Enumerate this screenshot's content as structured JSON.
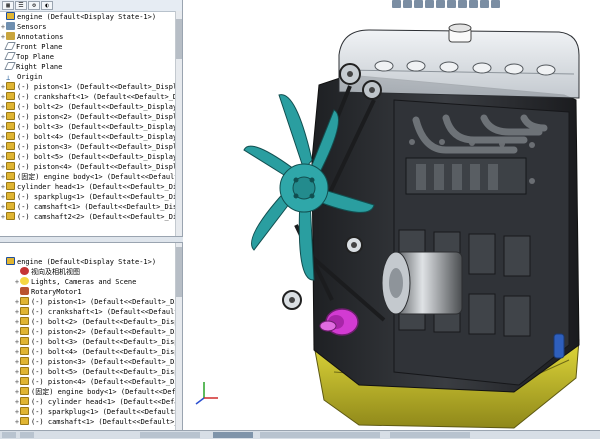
{
  "tree_top": {
    "root": "engine  (Default<Display State-1>)",
    "items": [
      {
        "label": "Sensors",
        "icon": "sensor-icon"
      },
      {
        "label": "Annotations",
        "icon": "annotation-icon"
      },
      {
        "label": "Front Plane",
        "icon": "plane-icon"
      },
      {
        "label": "Top Plane",
        "icon": "plane-icon"
      },
      {
        "label": "Right Plane",
        "icon": "plane-icon"
      },
      {
        "label": "Origin",
        "icon": "origin-icon"
      },
      {
        "label": "(-) piston<1> (Default<<Default>_Display Stat",
        "icon": "part-icon"
      },
      {
        "label": "(-) crankshaft<1> (Default<<Default>_Display S",
        "icon": "part-icon"
      },
      {
        "label": "(-) bolt<2> (Default<<Default>_Display State",
        "icon": "part-icon"
      },
      {
        "label": "(-) piston<2> (Default<<Default>_Display Stat",
        "icon": "part-icon"
      },
      {
        "label": "(-) bolt<3> (Default<<Default>_Display State",
        "icon": "part-icon"
      },
      {
        "label": "(-) bolt<4> (Default<<Default>_Display State",
        "icon": "part-icon"
      },
      {
        "label": "(-) piston<3> (Default<<Default>_Display Stat",
        "icon": "part-icon"
      },
      {
        "label": "(-) bolt<5> (Default<<Default>_Display State",
        "icon": "part-icon"
      },
      {
        "label": "(-) piston<4> (Default<<Default>_Display Stat",
        "icon": "part-icon"
      },
      {
        "label": "(固定) engine body<1> (Default<<Default>_Displa",
        "icon": "part-icon"
      },
      {
        "label": "cylinder head<1> (Default<<Default>_Display S",
        "icon": "part-icon"
      },
      {
        "label": "(-) sparkplug<1> (Default<<Default>_Display S",
        "icon": "part-icon"
      },
      {
        "label": "(-) camshaft<1> (Default<<Default>_Display S",
        "icon": "part-icon"
      },
      {
        "label": "(-) camshaft2<2> (Default<<Default>_Display S",
        "icon": "part-icon"
      }
    ]
  },
  "tree_bottom": {
    "root": "engine  (Default<Display State-1>)",
    "items": [
      {
        "label": "视向及相机视图",
        "icon": "view-icon"
      },
      {
        "label": "Lights, Cameras and Scene",
        "icon": "light-icon"
      },
      {
        "label": "RotaryMotor1",
        "icon": "motor-icon"
      },
      {
        "label": "(-) piston<1> (Default<<Default>_Display St",
        "icon": "part-icon"
      },
      {
        "label": "(-) crankshaft<1> (Default<<Default>_Displ",
        "icon": "part-icon"
      },
      {
        "label": "(-) bolt<2> (Default<<Default>_Display Sta",
        "icon": "part-icon"
      },
      {
        "label": "(-) piston<2> (Default<<Default>_Display St",
        "icon": "part-icon"
      },
      {
        "label": "(-) bolt<3> (Default<<Default>_Display Sta",
        "icon": "part-icon"
      },
      {
        "label": "(-) bolt<4> (Default<<Default>_Display Sta",
        "icon": "part-icon"
      },
      {
        "label": "(-) piston<3> (Default<<Default>_Display St",
        "icon": "part-icon"
      },
      {
        "label": "(-) bolt<5> (Default<<Default>_Display Sta",
        "icon": "part-icon"
      },
      {
        "label": "(-) piston<4> (Default<<Default>_Display St",
        "icon": "part-icon"
      },
      {
        "label": "(固定) engine body<1> (Default<<Default>_Di",
        "icon": "part-icon"
      },
      {
        "label": "(-) cylinder head<1> (Default<<Default>_Dis",
        "icon": "part-icon"
      },
      {
        "label": "(-) sparkplug<1> (Default<<Default>_Displa",
        "icon": "part-icon"
      },
      {
        "label": "(-) camshaft<1> (Default<<Default>_Display",
        "icon": "part-icon"
      }
    ]
  },
  "colors": {
    "engine_block": "#2f3236",
    "oil_pan": "#c9c12a",
    "fan": "#2a9ea0",
    "pulley_magenta": "#d23bd2",
    "head_cover": "#d8dde2",
    "hose_blue": "#2e5fbd"
  }
}
